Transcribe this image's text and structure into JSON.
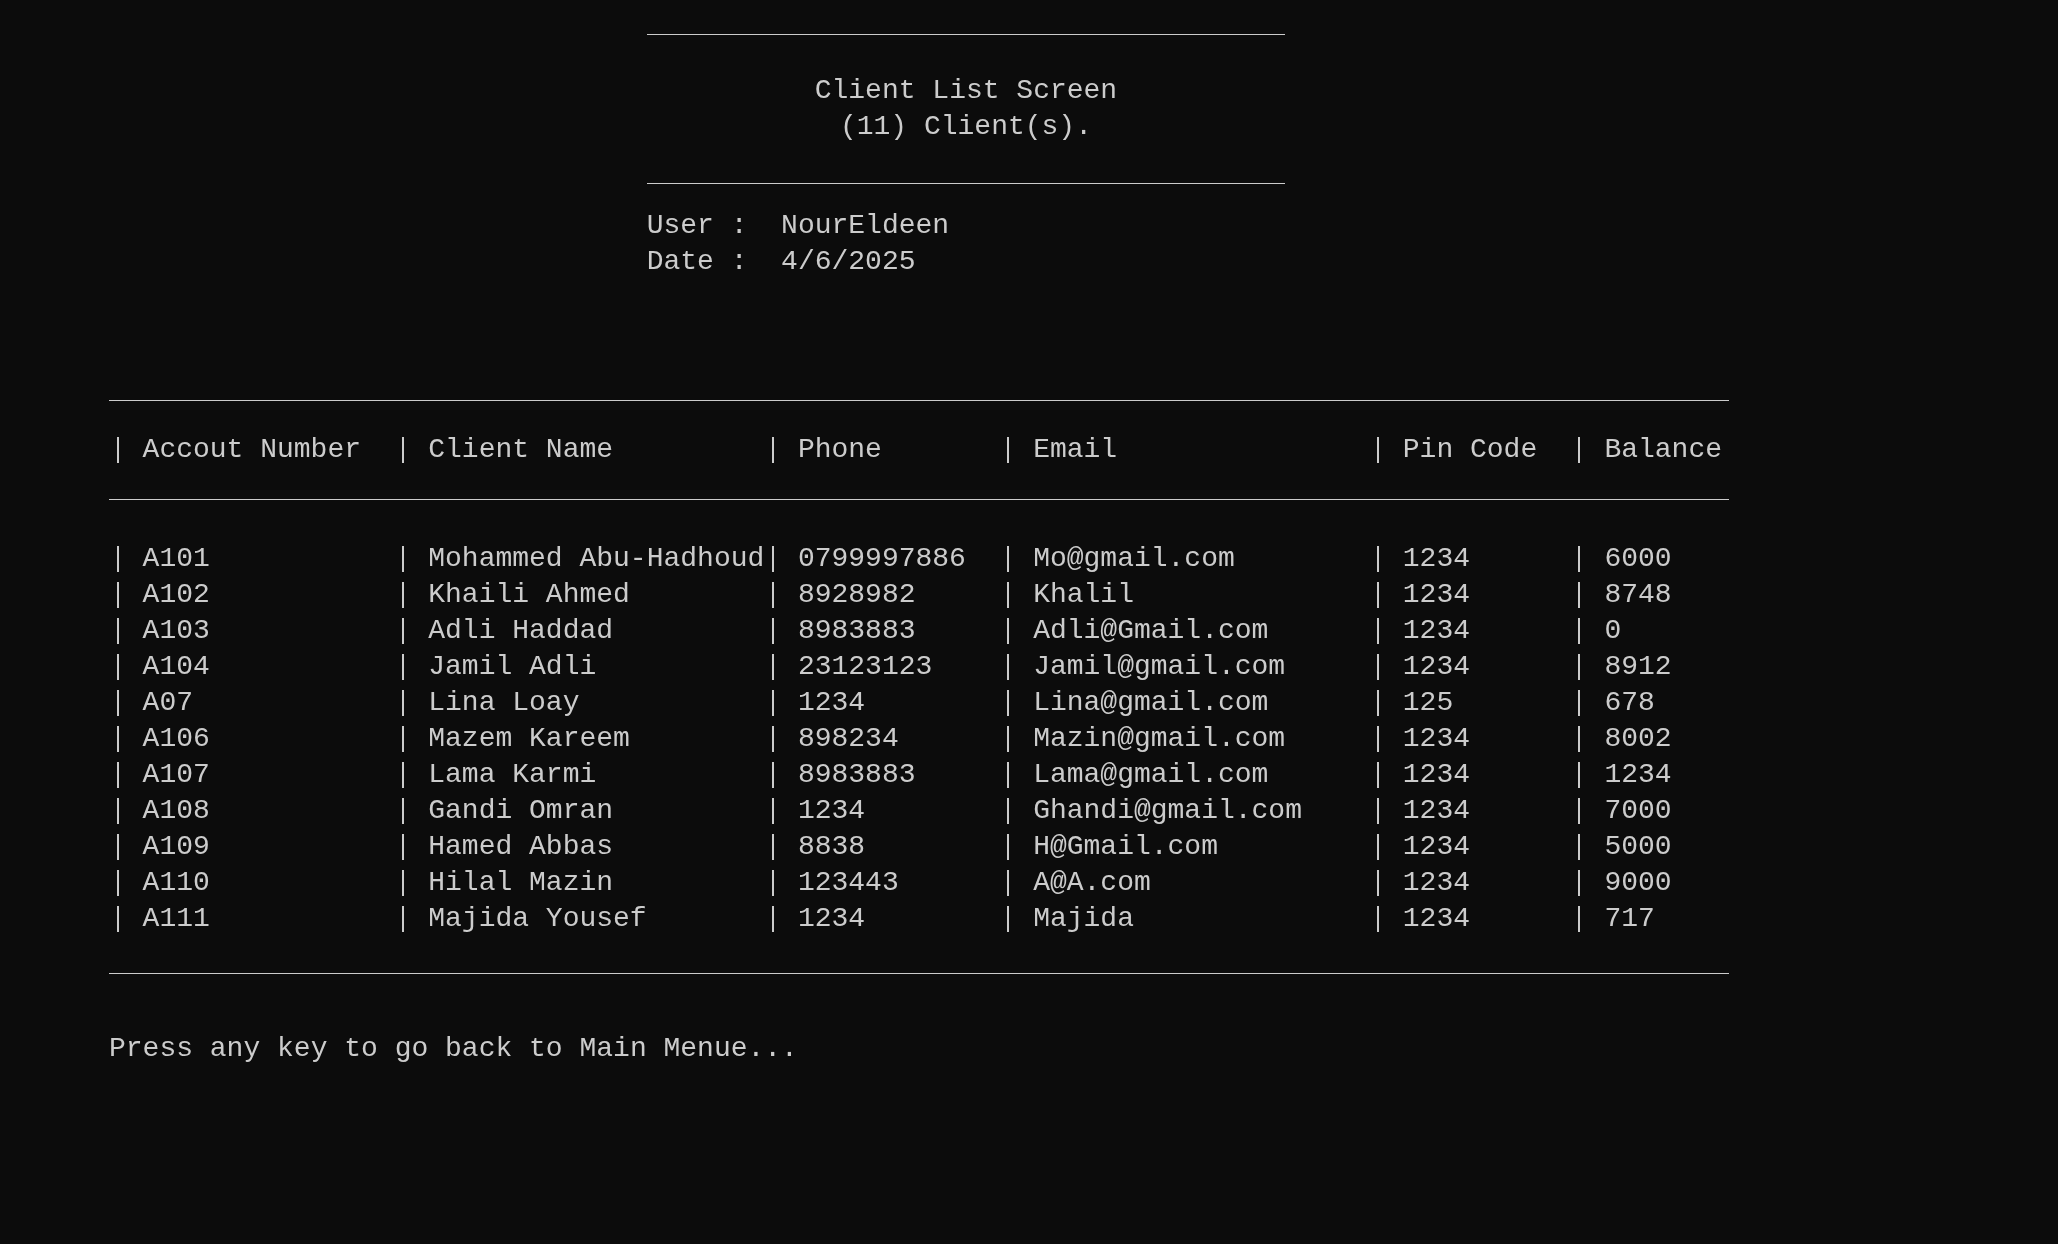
{
  "header": {
    "title": "Client List Screen",
    "subtitle": "(11) Client(s)."
  },
  "info": [
    {
      "label": "User :",
      "value": "NourEldeen"
    },
    {
      "label": "Date :",
      "value": "4/6/2025"
    }
  ],
  "table": {
    "columns": [
      "Accout Number",
      "Client Name",
      "Phone",
      "Email",
      "Pin Code",
      "Balance"
    ],
    "rows": [
      [
        "A101",
        "Mohammed Abu-Hadhoud",
        "0799997886",
        "Mo@gmail.com",
        "1234",
        "6000"
      ],
      [
        "A102",
        "Khaili Ahmed",
        "8928982",
        "Khalil",
        "1234",
        "8748"
      ],
      [
        "A103",
        "Adli Haddad",
        "8983883",
        "Adli@Gmail.com",
        "1234",
        "0"
      ],
      [
        "A104",
        "Jamil Adli",
        "23123123",
        "Jamil@gmail.com",
        "1234",
        "8912"
      ],
      [
        "A07",
        "Lina Loay",
        "1234",
        "Lina@gmail.com",
        "125",
        "678"
      ],
      [
        "A106",
        "Mazem Kareem",
        "898234",
        "Mazin@gmail.com",
        "1234",
        "8002"
      ],
      [
        "A107",
        "Lama Karmi",
        "8983883",
        "Lama@gmail.com",
        "1234",
        "1234"
      ],
      [
        "A108",
        "Gandi Omran",
        "1234",
        "Ghandi@gmail.com",
        "1234",
        "7000"
      ],
      [
        "A109",
        "Hamed Abbas",
        "8838",
        "H@Gmail.com",
        "1234",
        "5000"
      ],
      [
        "A110",
        "Hilal Mazin",
        "123443",
        "A@A.com",
        "1234",
        "9000"
      ],
      [
        "A111",
        "Majida Yousef",
        "1234",
        "Majida",
        "1234",
        "717"
      ]
    ]
  },
  "prompt": "Press any key to go back to Main Menue..."
}
